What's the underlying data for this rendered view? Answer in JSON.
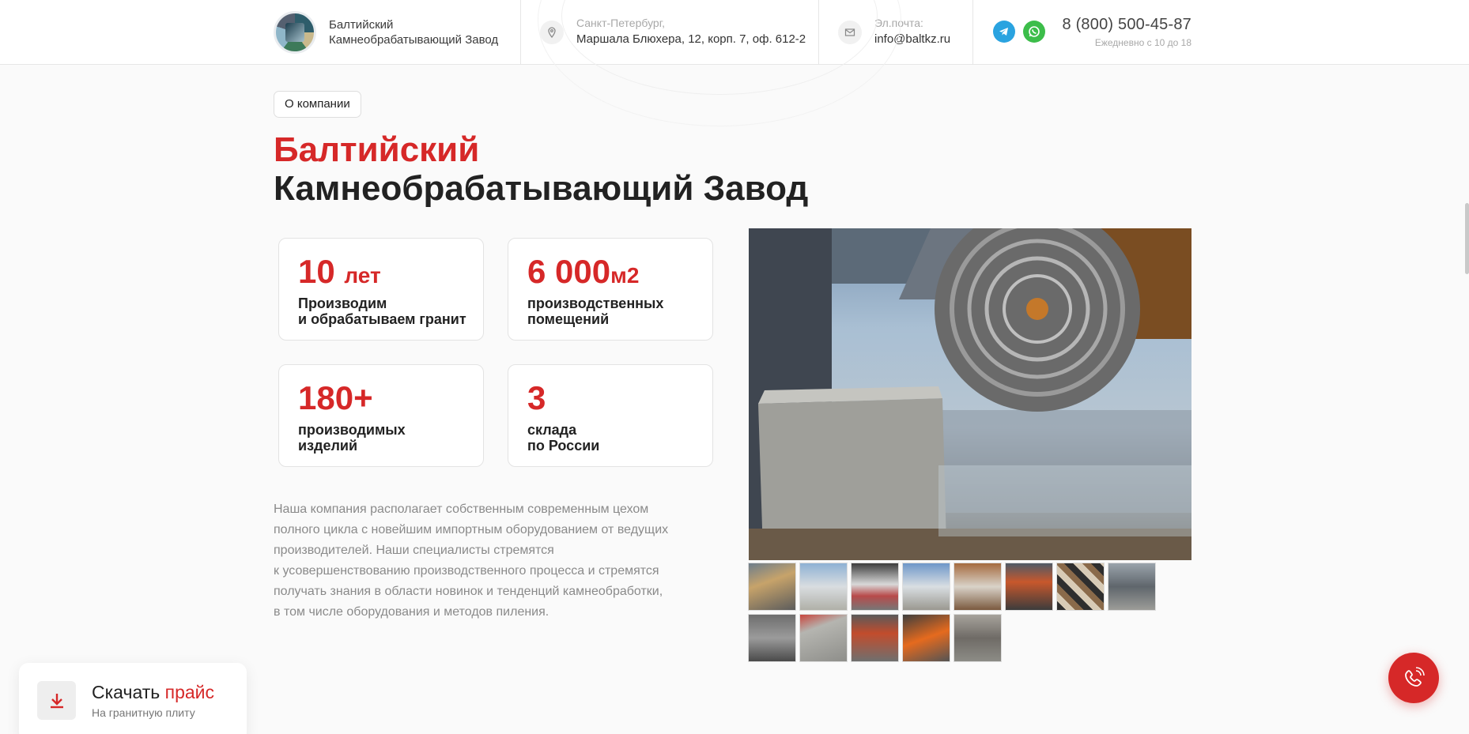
{
  "header": {
    "company_line1": "Балтийский",
    "company_line2": "Камнеобрабатывающий Завод",
    "address_label": "Санкт-Петербург,",
    "address_value": "Маршала Блюхера, 12, корп. 7, оф. 612-2",
    "email_label": "Эл.почта:",
    "email_value": "info@baltkz.ru",
    "phone": "8 (800) 500-45-87",
    "hours": "Ежедневно с 10 до 18"
  },
  "about": {
    "chip": "О компании",
    "title_red": "Балтийский",
    "title_black": "Камнеобрабатывающий Завод",
    "stats": [
      {
        "num": "10",
        "unit": "лет",
        "line1": "Производим",
        "line2": "и обрабатываем гранит"
      },
      {
        "num": "6 000",
        "unit": "м2",
        "line1": "производственных",
        "line2": "помещений"
      },
      {
        "num": "180+",
        "unit": "",
        "line1": "производимых",
        "line2": "изделий"
      },
      {
        "num": "3",
        "unit": "",
        "line1": "склада",
        "line2": "по России"
      }
    ],
    "text_lines": [
      "Наша компания располагает собственным современным цехом",
      "полного цикла с новейшим импортным оборудованием от ведущих",
      "производителей. Наши специалисты стремятся",
      "к усовершенствованию производственного процесса и стремятся",
      "получать знания в области новинок и тенденций камнеобработки,",
      "в том числе оборудования и методов пиления."
    ]
  },
  "gallery": {
    "main_image": "stone-cutting-saw-photo",
    "thumb_count": 13
  },
  "price_widget": {
    "title_black": "Скачать",
    "title_red": "прайс",
    "subtitle": "На гранитную плиту"
  },
  "colors": {
    "accent": "#d62828",
    "telegram": "#2aa3e0",
    "whatsapp": "#3cbd4a"
  }
}
